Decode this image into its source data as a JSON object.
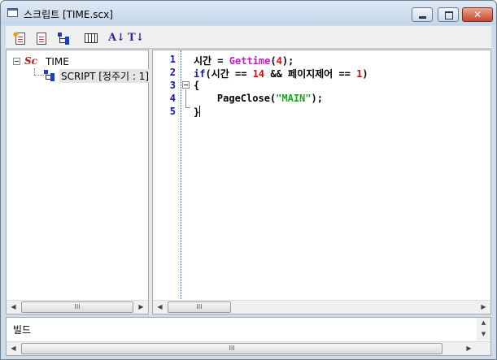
{
  "window": {
    "title": "스크립트 [TIME.scx]"
  },
  "toolbar": {
    "icons": [
      "new-script-icon",
      "document-icon",
      "tree-icon",
      "grid-icon",
      "font-size-icon",
      "text-size-icon"
    ],
    "font_glyph": "A↓",
    "text_glyph": "T↓"
  },
  "tree": {
    "root_icon": "Sc",
    "root_label": "TIME",
    "child_label": "SCRIPT [정주기 : 1]"
  },
  "editor": {
    "line_numbers": [
      "1",
      "2",
      "3",
      "4",
      "5"
    ],
    "lines": [
      [
        {
          "t": "시간 = ",
          "c": ""
        },
        {
          "t": "Gettime",
          "c": "fn"
        },
        {
          "t": "(",
          "c": ""
        },
        {
          "t": "4",
          "c": "num"
        },
        {
          "t": ");",
          "c": ""
        }
      ],
      [
        {
          "t": "if",
          "c": "kw"
        },
        {
          "t": "(시간 == ",
          "c": ""
        },
        {
          "t": "14",
          "c": "num"
        },
        {
          "t": " && 페이지제어 == ",
          "c": ""
        },
        {
          "t": "1",
          "c": "num"
        },
        {
          "t": ")",
          "c": ""
        }
      ],
      [
        {
          "t": "{",
          "c": ""
        }
      ],
      [
        {
          "t": "    PageClose(",
          "c": ""
        },
        {
          "t": "\"MAIN\"",
          "c": "str"
        },
        {
          "t": ");",
          "c": ""
        }
      ],
      [
        {
          "t": "}",
          "c": ""
        }
      ]
    ]
  },
  "scrollbar": {
    "thumb_glyph": "III"
  },
  "output": {
    "label": "빌드"
  },
  "colors": {
    "keyword": "#1313b8",
    "function": "#c717c7",
    "number": "#d01010",
    "string": "#1aa51a"
  }
}
